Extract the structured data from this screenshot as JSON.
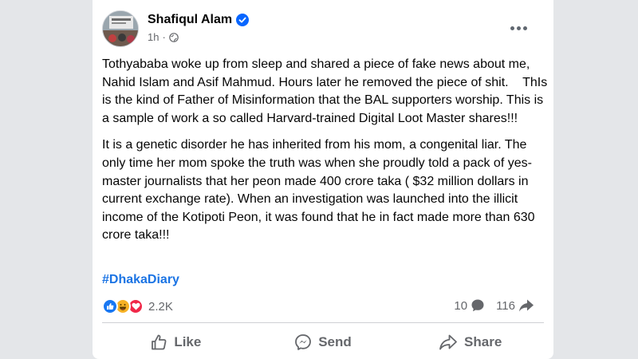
{
  "post": {
    "author": "Shafiqul Alam",
    "time": "1h",
    "paragraphs": [
      "Tothyababa woke up from sleep and shared a piece of fake news about me, Nahid Islam and Asif Mahmud. Hours later he removed the piece of shit.    ThIs is the kind of Father of Misinformation that the BAL supporters worship. This is a sample of work a so called Harvard-trained Digital Loot Master shares!!!",
      "It is a genetic disorder he has inherited from his mom, a congenital liar. The only time her mom spoke the truth was when she proudly told a pack of yes-master journalists that her peon made 400 crore taka ( $32 million dollars in current exchange rate). When an investigation was launched into the illicit income of the Kotipoti Peon, it was found that he in fact made more than 630 crore taka!!!"
    ],
    "hashtag": "#DhakaDiary"
  },
  "stats": {
    "reactions_count": "2.2K",
    "comments_count": "10",
    "shares_count": "116",
    "reaction_icons": [
      "like-icon",
      "haha-icon",
      "love-icon"
    ]
  },
  "actions": {
    "like_label": "Like",
    "send_label": "Send",
    "share_label": "Share"
  },
  "colors": {
    "link_blue": "#1b74e4",
    "verified_blue": "#0866ff",
    "like_blue": "#1877f2",
    "love_red": "#f02849",
    "haha_yellow": "#f7b125",
    "secondary_text": "#65676b"
  },
  "icons": {
    "more": "more-options-icon",
    "globe": "globe-icon",
    "verified": "verified-badge-icon",
    "comment": "comment-icon",
    "share": "share-icon",
    "like_action": "thumbs-up-icon",
    "send_action": "messenger-icon",
    "share_action": "share-arrow-icon"
  }
}
